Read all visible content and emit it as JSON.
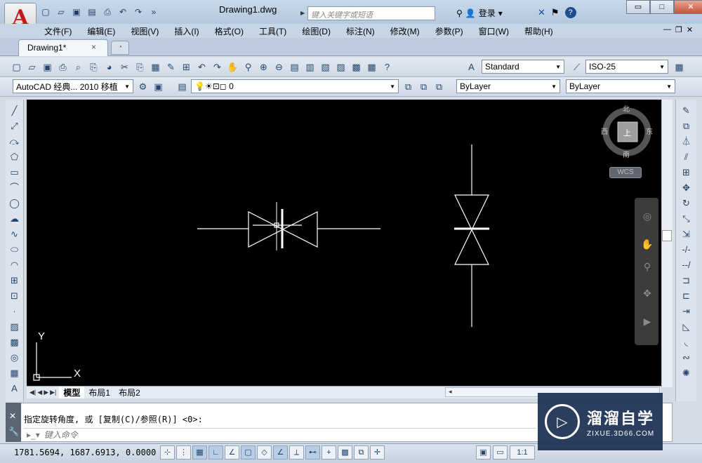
{
  "window": {
    "title": "Drawing1.dwg",
    "search_placeholder": "键入关键字或短语",
    "login_label": "登录",
    "min_label": "▭",
    "max_label": "□",
    "close_label": "✕"
  },
  "menubar": {
    "items": [
      "文件(F)",
      "编辑(E)",
      "视图(V)",
      "插入(I)",
      "格式(O)",
      "工具(T)",
      "绘图(D)",
      "标注(N)",
      "修改(M)",
      "参数(P)",
      "窗口(W)",
      "帮助(H)"
    ]
  },
  "doc_tabs": {
    "active": "Drawing1*",
    "close_glyph": "×"
  },
  "toolbar": {
    "text_style": "Standard",
    "dim_style": "ISO-25",
    "workspace": "AutoCAD 经典... 2010 移植",
    "layer": "0",
    "color": "ByLayer",
    "linetype": "ByLayer"
  },
  "viewcube": {
    "north": "北",
    "south": "南",
    "east": "东",
    "west": "西",
    "wcs": "WCS"
  },
  "ucs": {
    "x": "X",
    "y": "Y"
  },
  "layout_tabs": [
    "模型",
    "布局1",
    "布局2"
  ],
  "command": {
    "history": "指定旋转角度, 或 [复制(C)/参照(R)] <0>:",
    "placeholder": "键入命令"
  },
  "status": {
    "coords": "1781.5694, 1687.6913, 0.0000",
    "annotation_scale": "1:1"
  },
  "watermark": {
    "title": "溜溜自学",
    "url": "ZIXUE.3D66.COM"
  },
  "colors": {
    "canvas": "#000000",
    "brand_red": "#c8151b",
    "watermark_bg": "#1f3254"
  },
  "icons": {
    "qat": [
      "new-icon",
      "open-icon",
      "save-icon",
      "saveas-icon",
      "plot-icon",
      "undo-icon",
      "redo-icon",
      "more-icon"
    ],
    "draw": [
      "line-icon",
      "construction-line-icon",
      "polyline-icon",
      "polygon-icon",
      "rectangle-icon",
      "arc-icon",
      "circle-icon",
      "revision-cloud-icon",
      "spline-icon",
      "ellipse-icon",
      "ellipse-arc-icon",
      "insert-block-icon",
      "make-block-icon",
      "point-icon",
      "hatch-icon",
      "gradient-icon",
      "region-icon",
      "table-icon",
      "mtext-icon"
    ],
    "modify": [
      "erase-icon",
      "copy-icon",
      "mirror-icon",
      "offset-icon",
      "array-icon",
      "move-icon",
      "rotate-icon",
      "scale-icon",
      "stretch-icon",
      "trim-icon",
      "extend-icon",
      "break-point-icon",
      "break-icon",
      "join-icon",
      "chamfer-icon",
      "fillet-icon",
      "blend-icon",
      "explode-icon"
    ]
  }
}
